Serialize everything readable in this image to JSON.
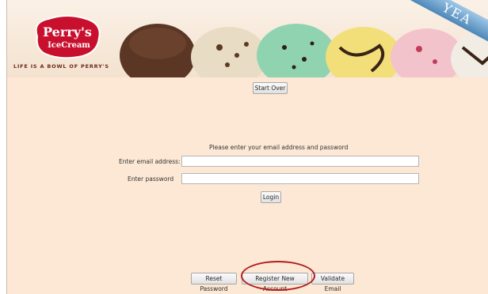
{
  "banner": {
    "brand_line1": "Perry's",
    "brand_line2": "IceCream",
    "tagline": "LIFE IS A BOWL OF PERRY'S",
    "ribbon_text": "YEA"
  },
  "actions": {
    "start_over": "Start Over",
    "login": "Login",
    "reset_password": "Reset Password",
    "register": "Register New Account",
    "validate_email": "Validate Email"
  },
  "login": {
    "prompt": "Please enter your email address and password",
    "email_label": "Enter email address:",
    "password_label": "Enter password",
    "email_value": "",
    "password_value": ""
  },
  "colors": {
    "page_bg": "#fce8d4",
    "highlight_circle": "#b11d20",
    "brand_red": "#c8102e"
  }
}
